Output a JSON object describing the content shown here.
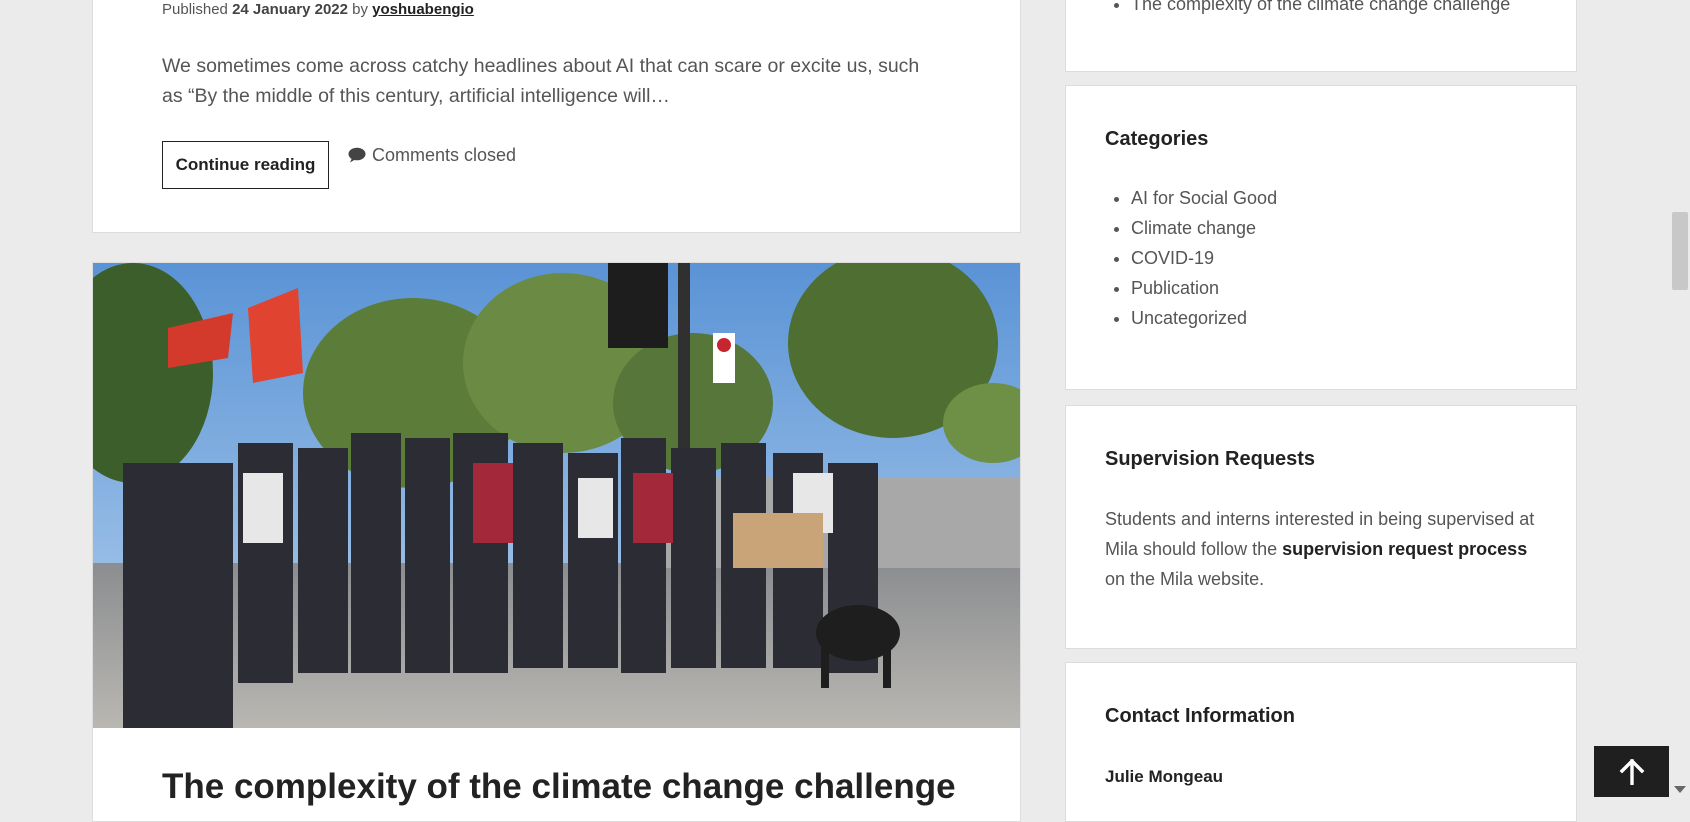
{
  "main": {
    "post": {
      "published_label": "Published",
      "date": "24 January 2022",
      "by_label": "by",
      "author": "yoshuabengio",
      "excerpt": "We sometimes come across catchy headlines about AI that can scare or excite us, such as “By the middle of this century, artificial intelligence will…",
      "continue_label": "Continue reading",
      "comments_label": "Comments closed"
    },
    "next_post": {
      "title": "The complexity of the climate change challenge"
    }
  },
  "sidebar": {
    "recent_posts": {
      "items": [
        "The complexity of the climate change challenge"
      ]
    },
    "categories": {
      "title": "Categories",
      "items": [
        "AI for Social Good",
        "Climate change",
        "COVID-19",
        "Publication",
        "Uncategorized"
      ]
    },
    "supervision": {
      "title": "Supervision Requests",
      "text_before": "Students and interns interested in being supervised at Mila should follow the",
      "link_text": "supervision request process",
      "text_after": "on the Mila website."
    },
    "contact": {
      "title": "Contact Information",
      "name": "Julie Mongeau"
    }
  },
  "icons": {
    "comment": "speech-bubble-icon",
    "back_to_top": "arrow-up-icon"
  },
  "colors": {
    "page_background": "#ebebeb",
    "card_background": "#ffffff",
    "heading": "#222222",
    "body_text": "#555555",
    "back_to_top_background": "#1f1f1f"
  }
}
